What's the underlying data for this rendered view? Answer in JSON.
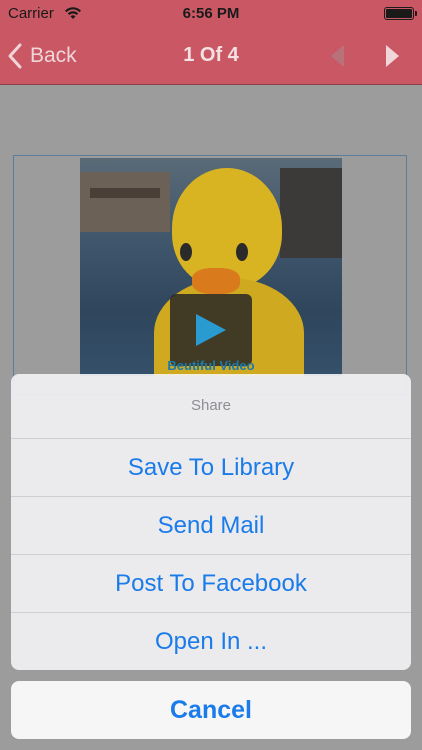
{
  "status_bar": {
    "carrier": "Carrier",
    "time": "6:56 PM"
  },
  "nav": {
    "back_label": "Back",
    "title": "1 Of 4"
  },
  "video": {
    "caption": "Beutiful Video"
  },
  "action_sheet": {
    "title": "Share",
    "options": [
      "Save To Library",
      "Send Mail",
      "Post To Facebook",
      "Open In ..."
    ],
    "cancel_label": "Cancel"
  },
  "colors": {
    "nav_bar": "#c95864",
    "action_text": "#1a7bea"
  },
  "icons": [
    "wifi-icon",
    "battery-icon",
    "chevron-left-icon",
    "chevron-right-icon",
    "play-icon"
  ]
}
